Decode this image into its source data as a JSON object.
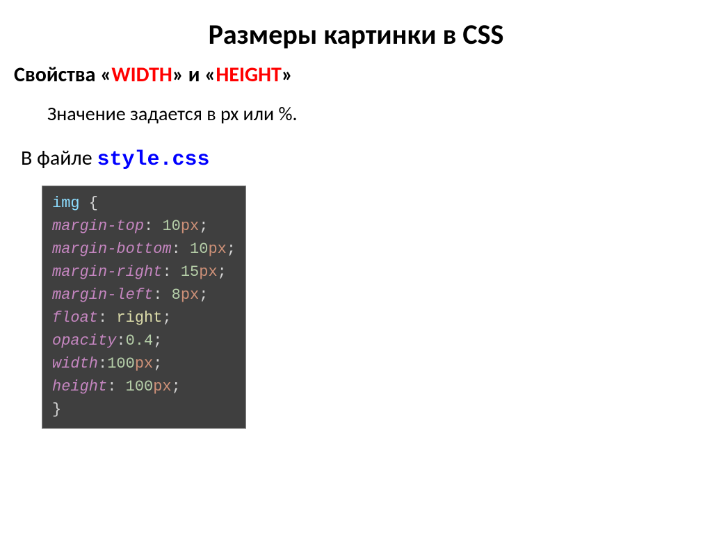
{
  "title": "Размеры картинки в CSS",
  "subtitle": {
    "prefix": "Свойства «",
    "w": "WIDTH",
    "mid": "» и «",
    "h": "HEIGHT",
    "suffix": "»"
  },
  "desc": "Значение задается в px или %.",
  "fileline": {
    "prefix": "В файле ",
    "file": "style.css"
  },
  "code": {
    "l0_sel": "img",
    "l0_brace": " {",
    "l1_p": "margin-top",
    "l1_c": ": ",
    "l1_n": "10",
    "l1_u": "px",
    "l1_s": ";",
    "l2_p": "margin-bottom",
    "l2_c": ": ",
    "l2_n": "10",
    "l2_u": "px",
    "l2_s": ";",
    "l3_p": "margin-right",
    "l3_c": ": ",
    "l3_n": "15",
    "l3_u": "px",
    "l3_s": ";",
    "l4_p": "margin-left",
    "l4_c": ": ",
    "l4_n": "8",
    "l4_u": "px",
    "l4_s": ";",
    "l5_p": "float",
    "l5_c": ": ",
    "l5_v": "right",
    "l5_s": ";",
    "l6_p": "opacity",
    "l6_c": ":",
    "l6_n": "0.4",
    "l6_s": ";",
    "l7_p": "width",
    "l7_c": ":",
    "l7_n": "100",
    "l7_u": "px",
    "l7_s": ";",
    "l8_p": "height",
    "l8_c": ": ",
    "l8_n": "100",
    "l8_u": "px",
    "l8_s": ";",
    "l9_brace": "}"
  }
}
